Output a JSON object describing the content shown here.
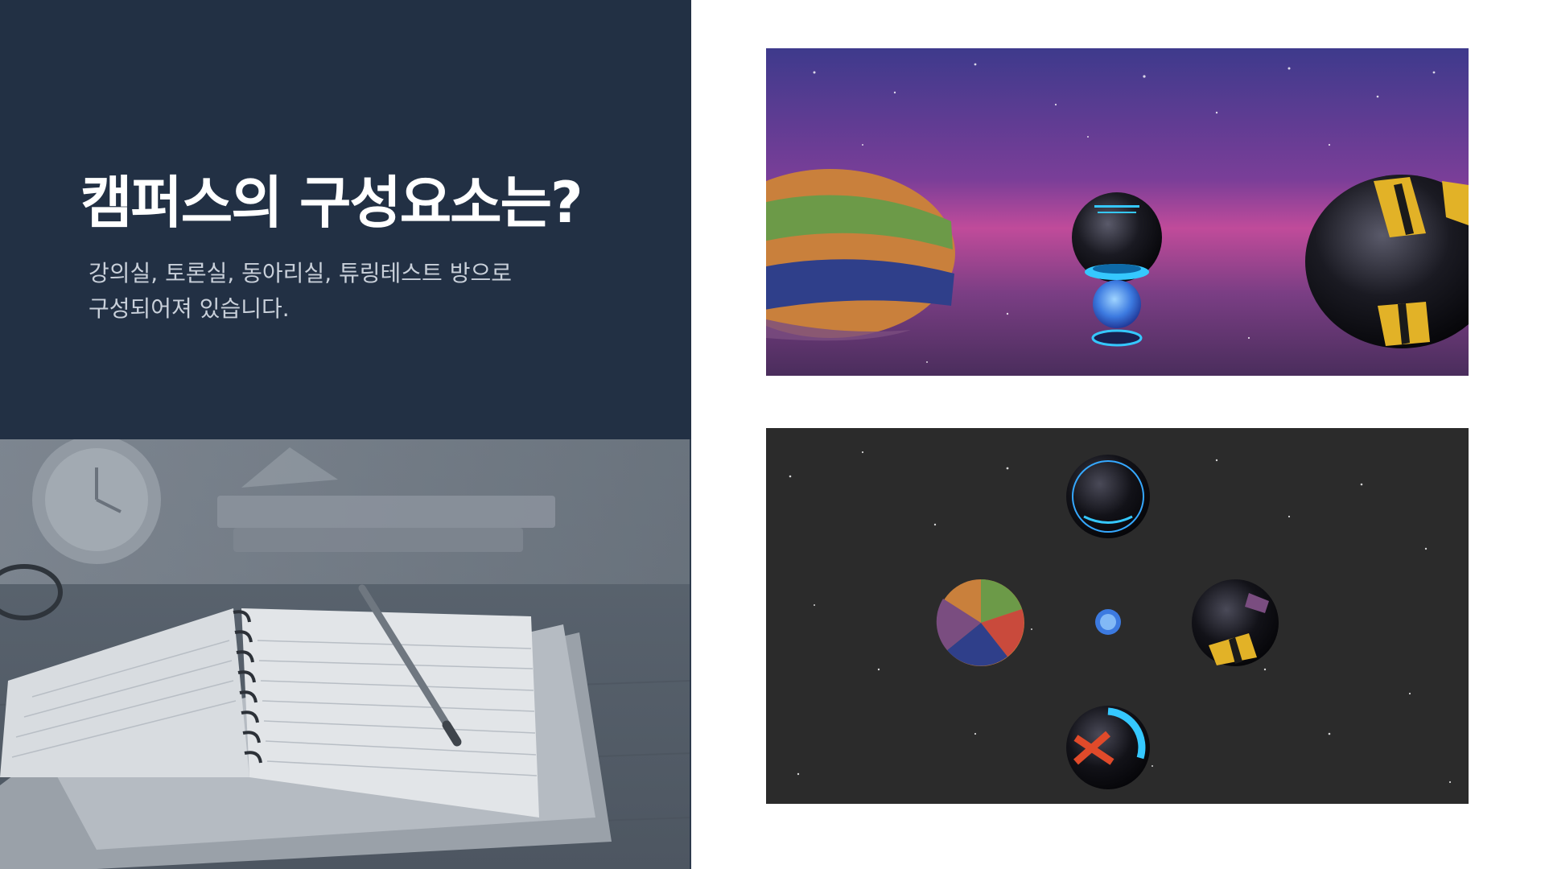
{
  "slide": {
    "title": "캠퍼스의 구성요소는?",
    "subtitle_lines": [
      "강의실, 토론실, 동아리실, 튜링테스트 방으로",
      "구성되어져 있습니다."
    ]
  },
  "colors": {
    "panel_dark": "#223044",
    "title_text": "#ffffff",
    "subtitle_text": "#c9d0da",
    "photo_tint": "#6b7480",
    "space_dark": "#2b2b2b"
  },
  "images": {
    "left_photo": "notebook-pencil-clock-photo",
    "top_screenshot": "campus-perspective-view-spheres",
    "bottom_screenshot": "campus-top-view-spheres"
  }
}
